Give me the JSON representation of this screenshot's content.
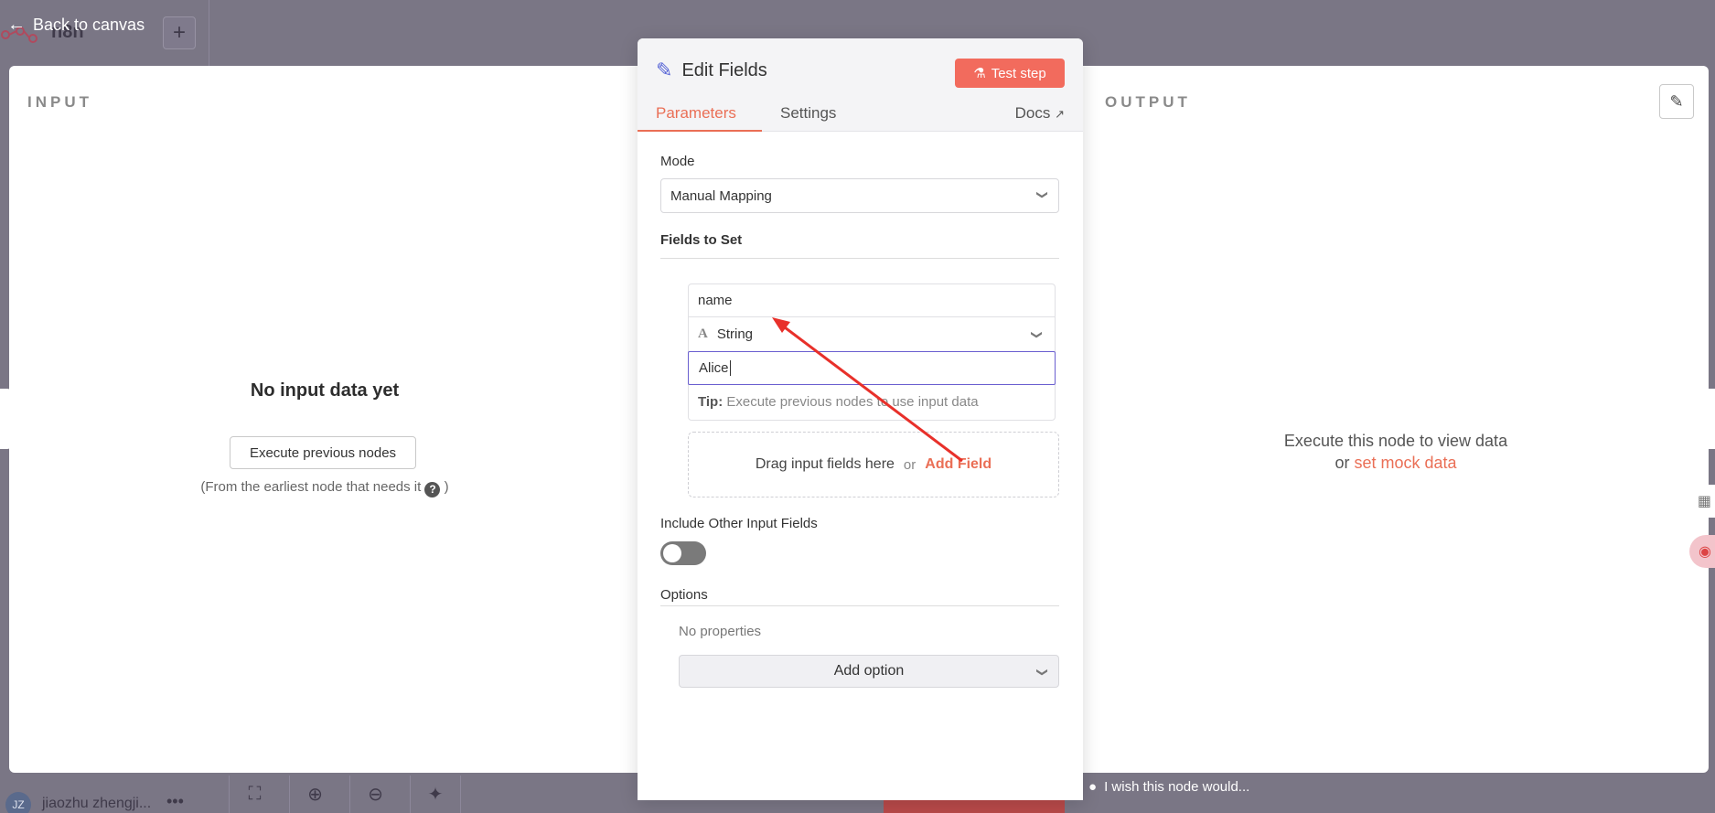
{
  "topbar": {
    "back_label": "Back to canvas",
    "logo_text": "n8n",
    "add_label": "+"
  },
  "input_panel": {
    "heading": "INPUT",
    "empty_title": "No input data yet",
    "execute_button": "Execute previous nodes",
    "hint_prefix": "(From the earliest node that needs it",
    "hint_suffix": ")",
    "help_glyph": "?"
  },
  "output_panel": {
    "heading": "OUTPUT",
    "message_line1": "Execute this node to view data",
    "message_or": "or",
    "mock_link": "set mock data"
  },
  "modal": {
    "title": "Edit Fields",
    "test_step": "Test step",
    "tabs": [
      {
        "label": "Parameters",
        "active": true
      },
      {
        "label": "Settings",
        "active": false
      }
    ],
    "docs_label": "Docs",
    "mode": {
      "label": "Mode",
      "value": "Manual Mapping"
    },
    "fields_to_set": {
      "label": "Fields to Set",
      "field": {
        "name": "name",
        "type": "String",
        "type_glyph": "A",
        "value": "Alice",
        "tip_label": "Tip:",
        "tip_text": "Execute previous nodes to use input data"
      },
      "drop_text": "Drag input fields here",
      "drop_or": "or",
      "add_field": "Add Field"
    },
    "include_other": {
      "label": "Include Other Input Fields",
      "enabled": false
    },
    "options": {
      "label": "Options",
      "empty_text": "No properties",
      "add_option": "Add option"
    }
  },
  "bottombar": {
    "avatar_initials": "JZ",
    "user_name": "jiaozhu zhengji...",
    "more": "•••",
    "wish_text": "I wish this node would..."
  },
  "colors": {
    "accent": "#ea6f56",
    "test_step_bg": "#f26b5d",
    "pencil": "#5563d6",
    "focus_border": "#6a5fd0",
    "overlay": "#7a7685",
    "annotation_arrow": "#e8302a"
  },
  "icons": {
    "back": "arrow-left-icon",
    "edit": "pencil-icon",
    "flask": "flask-icon",
    "external": "external-link-icon",
    "chevron": "chevron-down-icon",
    "bulb": "lightbulb-icon"
  }
}
